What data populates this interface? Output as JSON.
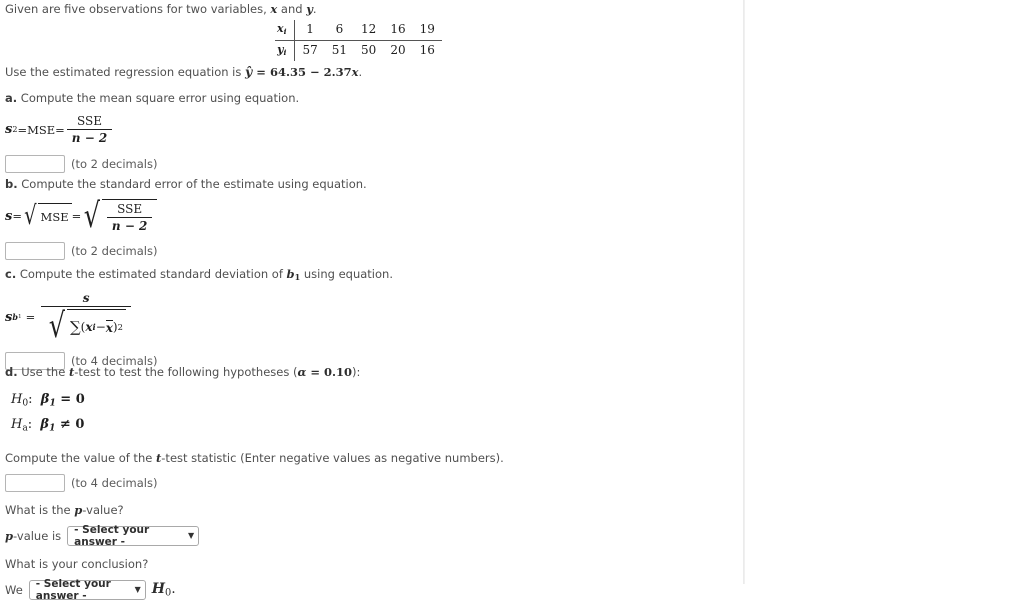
{
  "problem": {
    "intro_prefix": "Given are five observations for two variables, ",
    "intro_var_x": "x",
    "intro_mid": " and ",
    "intro_var_y": "y",
    "intro_suffix": ".",
    "regression_prefix": "Use the estimated regression equation is ",
    "regression_yhat": "ŷ",
    "regression_equals": " = ",
    "regression_intercept": "64.35",
    "regression_operator": " − ",
    "regression_slope": "2.37",
    "regression_var": "x",
    "regression_period": "."
  },
  "table": {
    "row_labels": [
      "xᵢ",
      "yᵢ"
    ],
    "x_label": "x",
    "y_label": "y",
    "sub_i": "i",
    "x_values": [
      "1",
      "6",
      "12",
      "16",
      "19"
    ],
    "y_values": [
      "57",
      "51",
      "50",
      "20",
      "16"
    ]
  },
  "parts": {
    "a": {
      "marker": "a.",
      "prompt": " Compute the mean square error using equation.",
      "formula": {
        "lhs_s": "s",
        "lhs_sup": "2",
        "eq1": " = ",
        "mse": "MSE",
        "eq2": " = ",
        "numerator": "SSE",
        "denominator": "n − 2"
      },
      "input_value": "",
      "input_placeholder": "",
      "hint": "(to 2 decimals)"
    },
    "b": {
      "marker": "b.",
      "prompt": " Compute the standard error of the estimate using equation.",
      "formula": {
        "lhs_s": "s",
        "eq1": " = ",
        "radicand_mse": "MSE",
        "eq2": " = ",
        "numerator": "SSE",
        "denominator": "n − 2"
      },
      "input_value": "",
      "input_placeholder": "",
      "hint": "(to 2 decimals)"
    },
    "c": {
      "marker": "c.",
      "prompt_pre": " Compute the estimated standard deviation of ",
      "prompt_b": "b",
      "prompt_b_sub": "1",
      "prompt_post": " using equation.",
      "formula": {
        "lhs_s": "s",
        "lhs_sub_b": "b",
        "lhs_sub_1": "1",
        "eq": " = ",
        "numerator": "s",
        "sigma": "∑",
        "open": "(",
        "xi": "x",
        "xi_sub": "i",
        "minus": " − ",
        "xbar": "x",
        "close": ")",
        "power": "2"
      },
      "input_value": "",
      "input_placeholder": "",
      "hint": "(to 4 decimals)"
    },
    "d": {
      "marker": "d.",
      "prompt_pre": " Use the ",
      "prompt_t": "t",
      "prompt_mid": "-test to test the following hypotheses (",
      "alpha": "α",
      "alpha_eq": " = ",
      "alpha_value": "0.10",
      "prompt_post": "):",
      "hypotheses": [
        {
          "name": "H",
          "sub": "0",
          "colon": ":",
          "beta": "β",
          "beta_sub": "1",
          "relation": " = ",
          "value": "0"
        },
        {
          "name": "H",
          "sub": "a",
          "colon": ":",
          "beta": "β",
          "beta_sub": "1",
          "relation": " ≠ ",
          "value": "0"
        }
      ],
      "statistic_prompt_pre": "Compute the value of the ",
      "statistic_prompt_t": "t",
      "statistic_prompt_post": "-test statistic (Enter negative values as negative numbers).",
      "statistic_input_value": "",
      "statistic_hint": "(to 4 decimals)",
      "pvalue_question_pre": "What is the ",
      "pvalue_question_p": "p",
      "pvalue_question_post": "-value?",
      "pvalue_label_p": "p",
      "pvalue_label_post": "-value is",
      "pvalue_select": "- Select your answer -",
      "conclusion_question": "What is your conclusion?",
      "conclusion_prefix": "We",
      "conclusion_select": "- Select your answer -",
      "conclusion_h": "H",
      "conclusion_h_sub": "0",
      "conclusion_period": "."
    }
  },
  "icons": {
    "caret": "▼"
  },
  "colors": {
    "text": "#4f4f4f",
    "math": "#1f1f1f",
    "input_border": "#b5b5b5",
    "divider": "#e3e3e3"
  }
}
